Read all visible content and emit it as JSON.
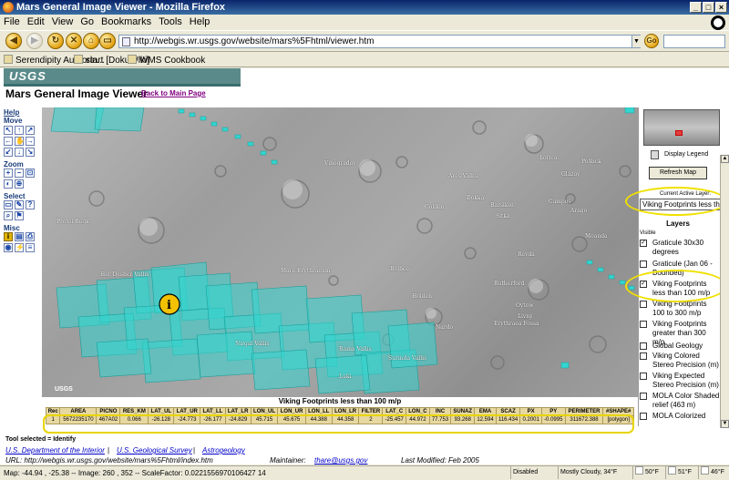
{
  "window": {
    "title": "Mars General Image Viewer - Mozilla Firefox",
    "btn_min": "_",
    "btn_max": "□",
    "btn_close": "×"
  },
  "menu": [
    "File",
    "Edit",
    "View",
    "Go",
    "Bookmarks",
    "Tools",
    "Help"
  ],
  "toolbar": {
    "url": "http://webgis.wr.usgs.gov/website/mars%5Fhtml/viewer.htm",
    "go_label": "Go",
    "search_value": ""
  },
  "bookmarks": [
    "Serendipity Authorin...",
    "start [DokuWiki]",
    "WMS Cookbook"
  ],
  "header": {
    "logo": "USGS",
    "title": "Mars General Image Viewer",
    "back_link": "Back to Main Page"
  },
  "tools": {
    "help": "Help",
    "move": "Move",
    "zoom": "Zoom",
    "select": "Select",
    "misc": "Misc"
  },
  "map": {
    "places": [
      "Vinogradov",
      "Ares Vallis",
      "Lorica",
      "Pollack",
      "Glazov",
      "Campos",
      "Arago",
      "Protei Regio",
      "Dokka",
      "Barsikol",
      "Golden",
      "Sitka",
      "Her Desher Vallis",
      "Mare Erythraeum",
      "Bigbee",
      "Holden",
      "Nirgal Vallis",
      "Raina Vallis",
      "Luki",
      "Surinda Vallis",
      "Nardo",
      "Erythraea Fossa",
      "Livny",
      "Oytow",
      "Revda",
      "Rutherford",
      "Moanda"
    ],
    "watermark": "USGS"
  },
  "result_table": {
    "title": "Viking Footprints less than 100 m/p",
    "columns": [
      "Rec",
      "AREA",
      "PICNO",
      "RES_KM",
      "LAT_UL",
      "LAT_UR",
      "LAT_LL",
      "LAT_LR",
      "LON_UL",
      "LON_UR",
      "LON_LL",
      "LON_LR",
      "FILTER",
      "LAT_C",
      "LON_C",
      "INC",
      "SUNAZ",
      "EMA",
      "SCAZ",
      "PX",
      "PY",
      "PERIMETER",
      "#SHAPE#"
    ],
    "rows": [
      [
        "1",
        "5672235170",
        "467A02",
        "0.066",
        "-26.128",
        "-24.773",
        "-26.177",
        "-24.829",
        "45.715",
        "45.675",
        "44.388",
        "44.358",
        "2",
        "-25.457",
        "44.972",
        "77.753",
        "93.268",
        "12.594",
        "116.434",
        "0.2001",
        "-0.0995",
        "311672.388",
        "[polygon]"
      ]
    ]
  },
  "tool_selected": "Tool selected = Identify",
  "footer": {
    "links": [
      "U.S. Department of the Interior",
      "U.S. Geological Survey",
      "Astrogeology"
    ],
    "separator": "|",
    "url_label": "URL: http://webgis.wr.usgs.gov/website/mars%5Fhtml/index.htm",
    "maint_label": "Maintainer:",
    "maint_email": "thare@usgs.gov",
    "modified": "Last Modified: Feb 2005"
  },
  "right_panel": {
    "display_legend": "Display Legend",
    "refresh": "Refresh Map",
    "active_layer_label": "Current Active Layer:",
    "active_layer_value": "Viking Footprints less than",
    "layers_head": "Layers",
    "visible": "Visible",
    "layers": [
      {
        "label": "Graticule 30x30 degrees",
        "checked": "✓"
      },
      {
        "label": "Graticule (Jan 06 - Bounded)",
        "checked": ""
      },
      {
        "label": "Viking Footprints less than 100 m/p",
        "checked": "✓"
      },
      {
        "label": "Viking Footprints 100 to 300 m/p",
        "checked": ""
      },
      {
        "label": "Viking Footprints greater than 300 m/p",
        "checked": ""
      },
      {
        "label": "Global Geology",
        "checked": ""
      },
      {
        "label": "Viking Colored Stereo Precision (m)",
        "checked": ""
      },
      {
        "label": "Viking Expected Stereo Precision (m)",
        "checked": ""
      },
      {
        "label": "MOLA Color Shaded relief (463 m)",
        "checked": ""
      },
      {
        "label": "MOLA Colorized",
        "checked": ""
      }
    ]
  },
  "status": {
    "coords": "Map: -44.94 , -25.38 -- Image: 260 , 352 -- ScaleFactor: 0.0221556970106427 14",
    "disabled": "Disabled",
    "weather": "Mostly Cloudy, 34°F",
    "t1": "50°F",
    "t2": "51°F",
    "t3": "46°F"
  }
}
